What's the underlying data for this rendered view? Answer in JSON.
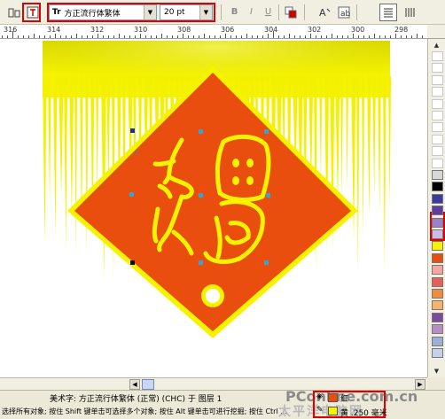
{
  "property_bar": {
    "font_family": "方正流行体繁体",
    "font_size": "20 pt",
    "font_type_icon": "truetype-font-icon",
    "format_buttons": [
      "B",
      "I",
      "U"
    ]
  },
  "ruler": {
    "labels": [
      "316",
      "314",
      "312",
      "310",
      "308",
      "306",
      "304",
      "302",
      "300",
      "298"
    ]
  },
  "palette": {
    "colors": [
      "#ffffff",
      "#ffffff",
      "#ffffff",
      "#ffffff",
      "#ffffff",
      "#ffffff",
      "#ffffff",
      "#ffffff",
      "#ffffff",
      "#ffffff",
      "#d8d8d8",
      "#000000",
      "#3b3b9f",
      "#5f3ca0",
      "#9a82c8",
      "#c9bde3",
      "#f7f300",
      "#e94e0f",
      "#f4a6a0",
      "#e85f57",
      "#f08c3c",
      "#f7b26b",
      "#7d4aa0",
      "#b58ec6",
      "#9ab0d8",
      "#c5d1eb"
    ],
    "highlighted": [
      "#f7f300",
      "#e94e0f"
    ]
  },
  "artwork": {
    "fringe_color": "#e7e800",
    "diamond_border": "#f7f300",
    "diamond_fill": "#e94e0f",
    "glyph_color": "#f7f300"
  },
  "status": {
    "line1": "美术字: 方正流行体繁体 (正常) (CHC) 于 图层 1",
    "line2": "选择所有对象; 按住 Shift 键单击可选择多个对象; 按住 Alt 键单击可进行挖掘; 按住 Ctrl ...",
    "fill_label": "红",
    "outline_label": "黄 .250 毫米",
    "fill_color": "#e94e0f",
    "outline_color": "#f7f300"
  },
  "watermark": {
    "brand": "PConline.com.cn",
    "cn": "太平洋电脑网"
  }
}
